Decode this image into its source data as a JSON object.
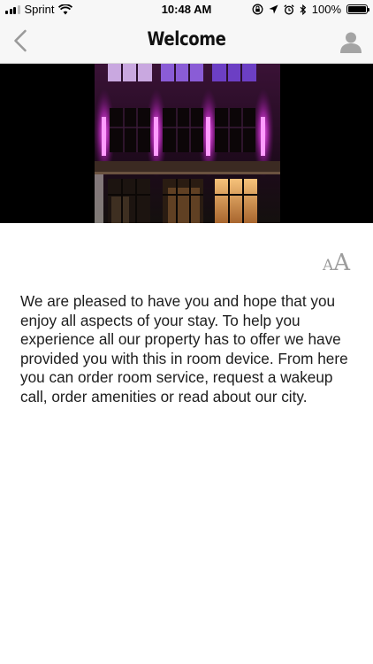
{
  "status_bar": {
    "carrier": "Sprint",
    "time": "10:48 AM",
    "battery_percent": "100%",
    "battery_level": 1.0,
    "icons": [
      "signal-icon",
      "wifi-icon",
      "screen-lock-icon",
      "location-icon",
      "alarm-icon",
      "bluetooth-icon",
      "battery-icon"
    ]
  },
  "nav": {
    "title": "Welcome",
    "back_icon": "chevron-left-icon",
    "profile_icon": "user-icon"
  },
  "font_size_control": {
    "small_glyph": "A",
    "large_glyph": "A"
  },
  "content": {
    "body": "We are pleased to have you and hope that you enjoy all aspects of your stay. To help you experience all our property has to offer we have provided you with this in room device. From here you can order room service, request a wakeup call, order amenities or read about our city."
  },
  "colors": {
    "bar_background": "#f7f7f7",
    "icon_gray": "#9c9c9c",
    "accent_magenta": "#e040e8"
  }
}
